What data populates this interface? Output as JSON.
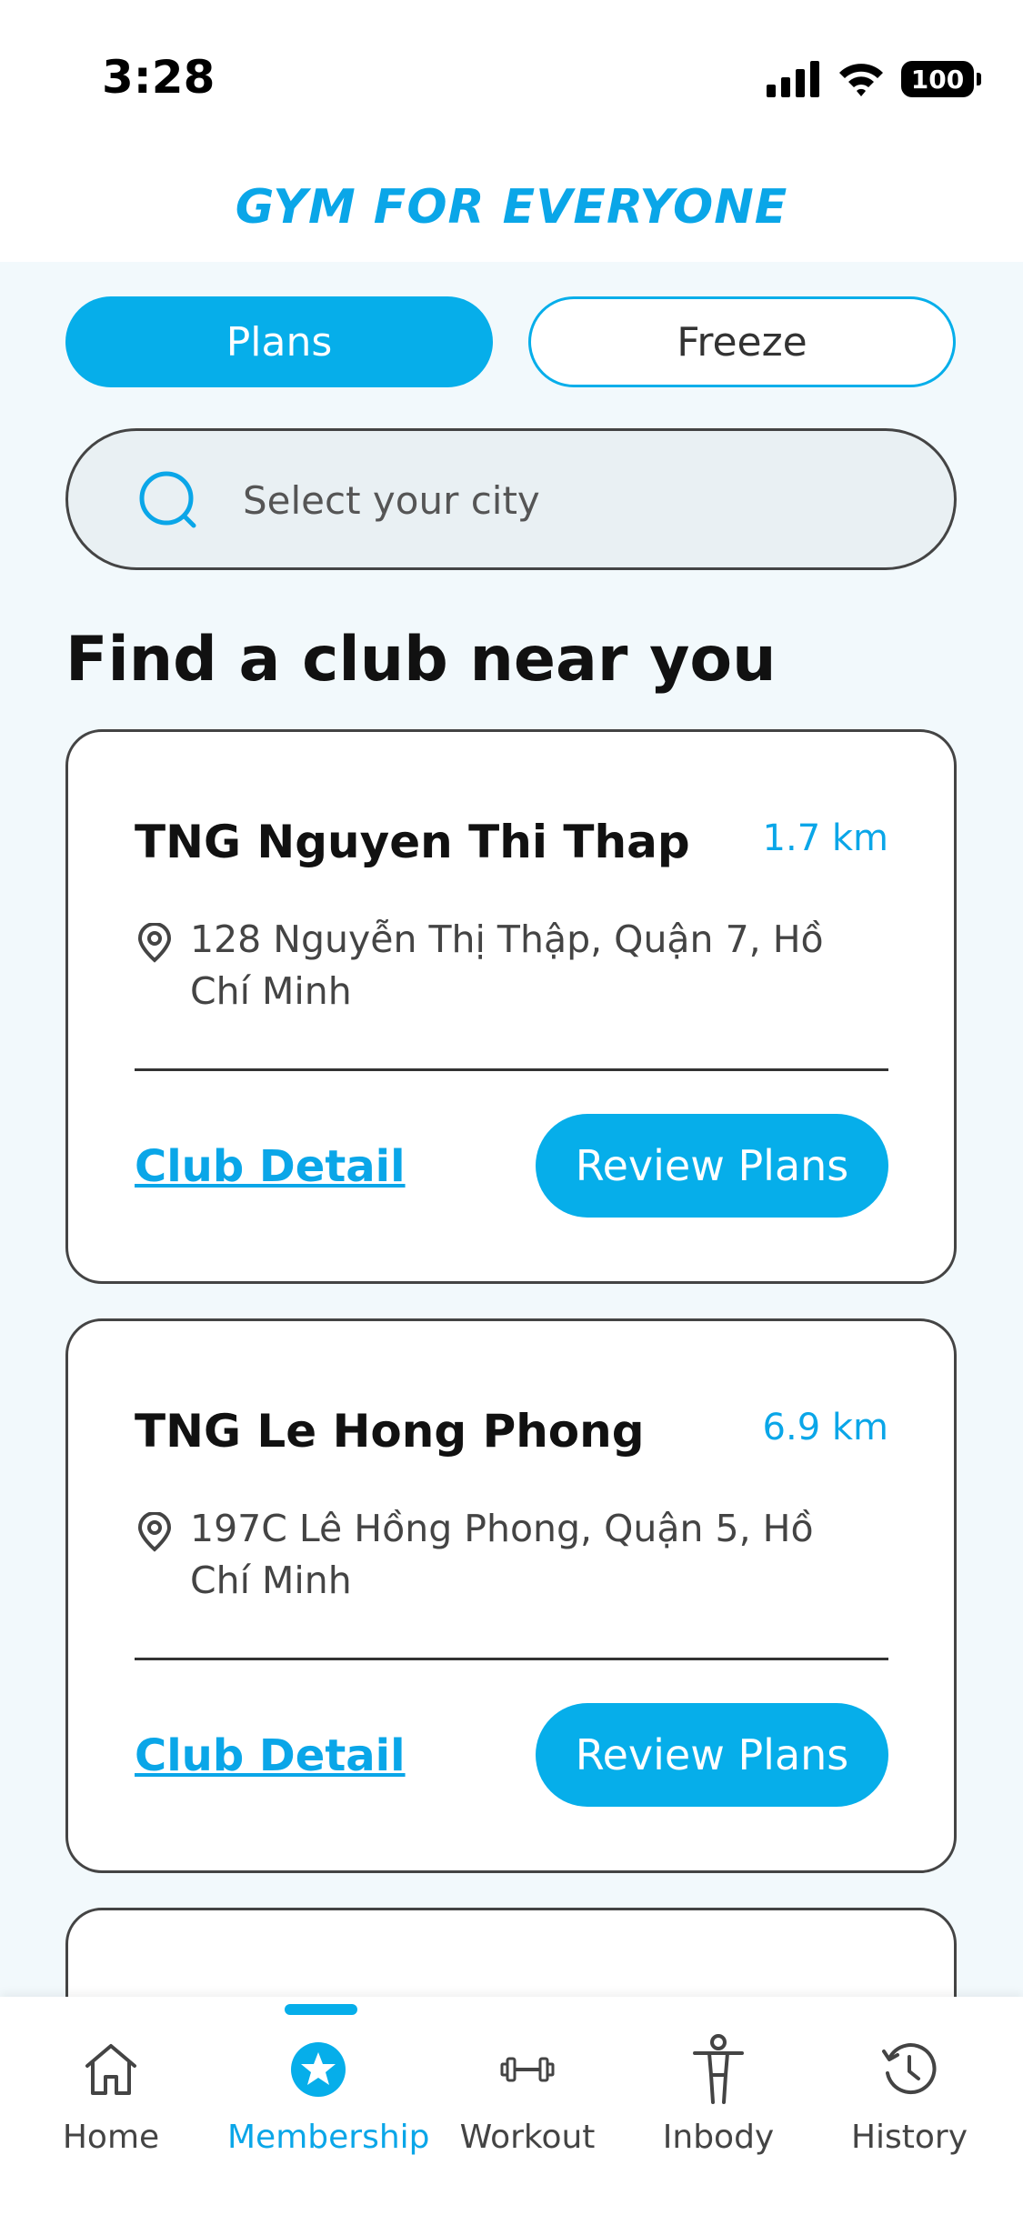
{
  "status_bar": {
    "time": "3:28",
    "battery": "100"
  },
  "header": {
    "brand": "GYM FOR EVERYONE"
  },
  "segments": {
    "plans_label": "Plans",
    "freeze_label": "Freeze",
    "active": "Plans"
  },
  "search": {
    "placeholder": "Select your city",
    "value": ""
  },
  "section_title": "Find a club near you",
  "clubs": [
    {
      "name": "TNG Nguyen Thi Thap",
      "distance": "1.7 km",
      "address": "128 Nguyễn Thị Thập, Quận 7, Hồ Chí Minh",
      "detail_label": "Club Detail",
      "review_label": "Review Plans"
    },
    {
      "name": "TNG Le Hong Phong",
      "distance": "6.9 km",
      "address": "197C Lê Hồng Phong, Quận 5, Hồ Chí Minh",
      "detail_label": "Club Detail",
      "review_label": "Review Plans"
    }
  ],
  "tabs": [
    {
      "label": "Home",
      "icon": "home-icon"
    },
    {
      "label": "Membership",
      "icon": "membership-star-icon",
      "active": true
    },
    {
      "label": "Workout",
      "icon": "dumbbell-icon"
    },
    {
      "label": "Inbody",
      "icon": "body-icon"
    },
    {
      "label": "History",
      "icon": "history-clock-icon"
    }
  ],
  "colors": {
    "accent": "#06aeea",
    "brand_text": "#0aa6e8"
  }
}
